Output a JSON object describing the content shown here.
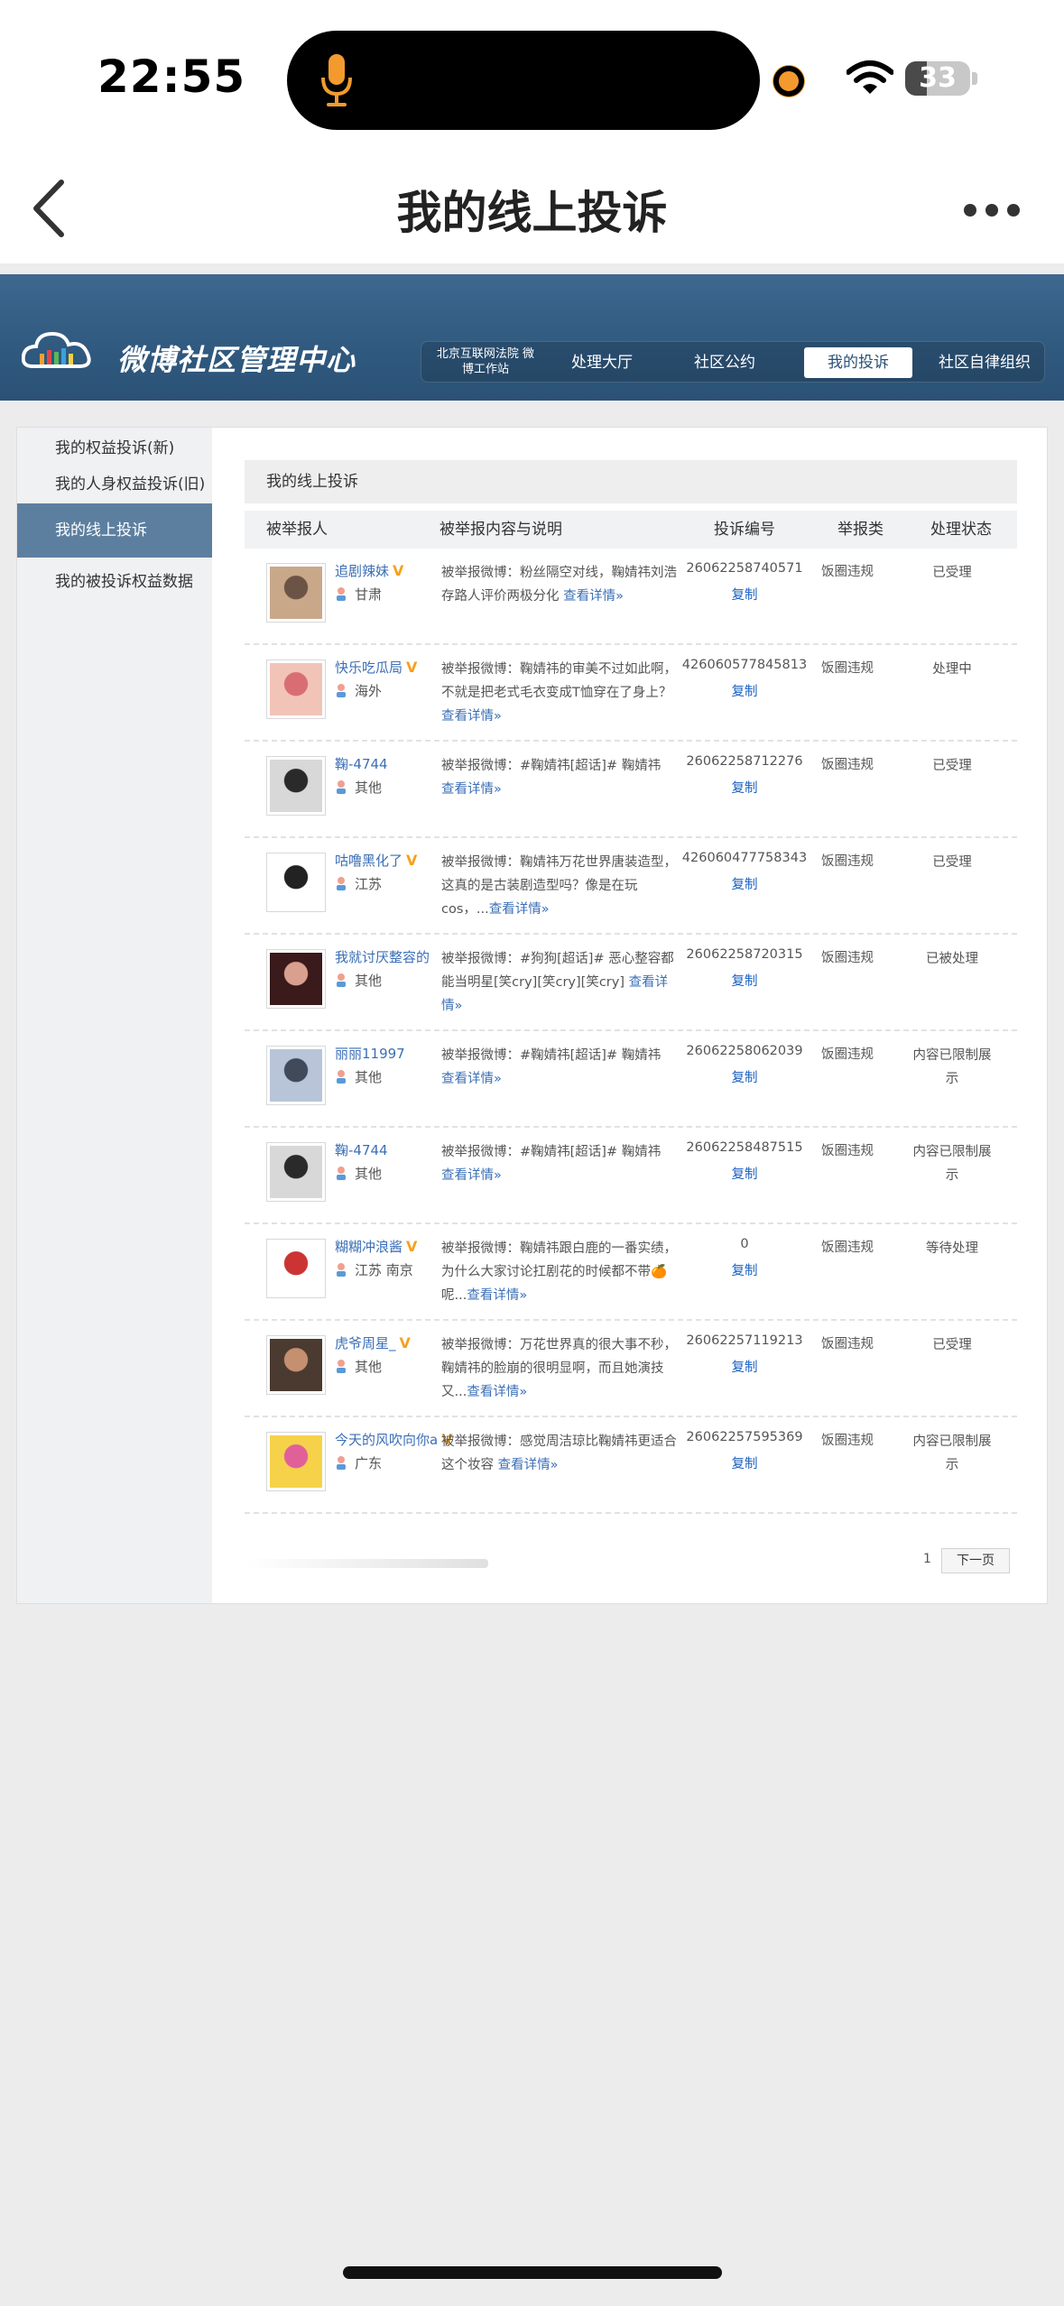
{
  "status_bar": {
    "time": "22:55",
    "battery": "33",
    "battery_level": 0.33
  },
  "nav": {
    "title": "我的线上投诉"
  },
  "weibo": {
    "title": "微博社区管理中心",
    "court_label": "北京互联网法院 微博工作站",
    "tabs": [
      "处理大厅",
      "社区公约",
      "我的投诉",
      "社区自律组织"
    ]
  },
  "sidebar": {
    "items": [
      "我的权益投诉(新)",
      "我的人身权益投诉(旧)",
      "我的线上投诉",
      "我的被投诉权益数据"
    ]
  },
  "panel": {
    "title": "我的线上投诉",
    "headers": [
      "被举报人",
      "被举报内容与说明",
      "投诉编号",
      "举报类",
      "处理状态"
    ]
  },
  "rows": [
    {
      "user": "追剧辣妹",
      "verified": true,
      "location": "甘肃",
      "content": "被举报微博：粉丝隔空对线，鞠婧祎刘浩存路人评价两极分化 ",
      "more": "查看详情»",
      "id": "26062258740571",
      "copy": "复制",
      "type": "饭圈违规",
      "status": "已受理"
    },
    {
      "user": "快乐吃瓜局",
      "verified": true,
      "location": "海外",
      "content": "被举报微博：鞠婧祎的审美不过如此啊，不就是把老式毛衣变成T恤穿在了身上？",
      "more": "查看详情»",
      "id": "426060577845813",
      "copy": "复制",
      "type": "饭圈违规",
      "status": "处理中"
    },
    {
      "user": "鞠-4744",
      "verified": false,
      "location": "其他",
      "content": "被举报微博：#鞠婧祎[超话]# 鞠婧祎 ",
      "more": "查看详情»",
      "id": "26062258712276",
      "copy": "复制",
      "type": "饭圈违规",
      "status": "已受理"
    },
    {
      "user": "咕噜黑化了",
      "verified": true,
      "location": "江苏",
      "content": "被举报微博：鞠婧祎万花世界唐装造型，这真的是古装剧造型吗？像是在玩cos，...",
      "more": "查看详情»",
      "id": "426060477758343",
      "copy": "复制",
      "type": "饭圈违规",
      "status": "已受理"
    },
    {
      "user": "我就讨厌整容的",
      "verified": false,
      "location": "其他",
      "content": "被举报微博：#狗狗[超话]# 恶心整容都能当明星[笑cry][笑cry][笑cry] ",
      "more": "查看详情»",
      "id": "26062258720315",
      "copy": "复制",
      "type": "饭圈违规",
      "status": "已被处理"
    },
    {
      "user": "丽丽11997",
      "verified": false,
      "location": "其他",
      "content": "被举报微博：#鞠婧祎[超话]# 鞠婧祎 ",
      "more": "查看详情»",
      "id": "26062258062039",
      "copy": "复制",
      "type": "饭圈违规",
      "status": "内容已限制展示"
    },
    {
      "user": "鞠-4744",
      "verified": false,
      "location": "其他",
      "content": "被举报微博：#鞠婧祎[超话]# 鞠婧祎 ",
      "more": "查看详情»",
      "id": "26062258487515",
      "copy": "复制",
      "type": "饭圈违规",
      "status": "内容已限制展示"
    },
    {
      "user": "糊糊冲浪酱",
      "verified": true,
      "location": "江苏 南京",
      "content": "被举报微博：鞠婧祎跟白鹿的一番实绩，为什么大家讨论扛剧花的时候都不带🍊呢...",
      "more": "查看详情»",
      "id": "0",
      "copy": "复制",
      "type": "饭圈违规",
      "status": "等待处理"
    },
    {
      "user": "虎爷周星_",
      "verified": true,
      "location": "其他",
      "content": "被举报微博：万花世界真的很大事不秒，鞠婧祎的脸崩的很明显啊，而且她演技又...",
      "more": "查看详情»",
      "id": "26062257119213",
      "copy": "复制",
      "type": "饭圈违规",
      "status": "已受理"
    },
    {
      "user": "今天的风吹向你a",
      "verified": true,
      "location": "广东",
      "content": "被举报微博：感觉周洁琼比鞠婧祎更适合这个妆容 ",
      "more": "查看详情»",
      "id": "26062257595369",
      "copy": "复制",
      "type": "饭圈违规",
      "status": "内容已限制展示"
    }
  ],
  "pager": {
    "page": "1",
    "next": "下一页"
  }
}
